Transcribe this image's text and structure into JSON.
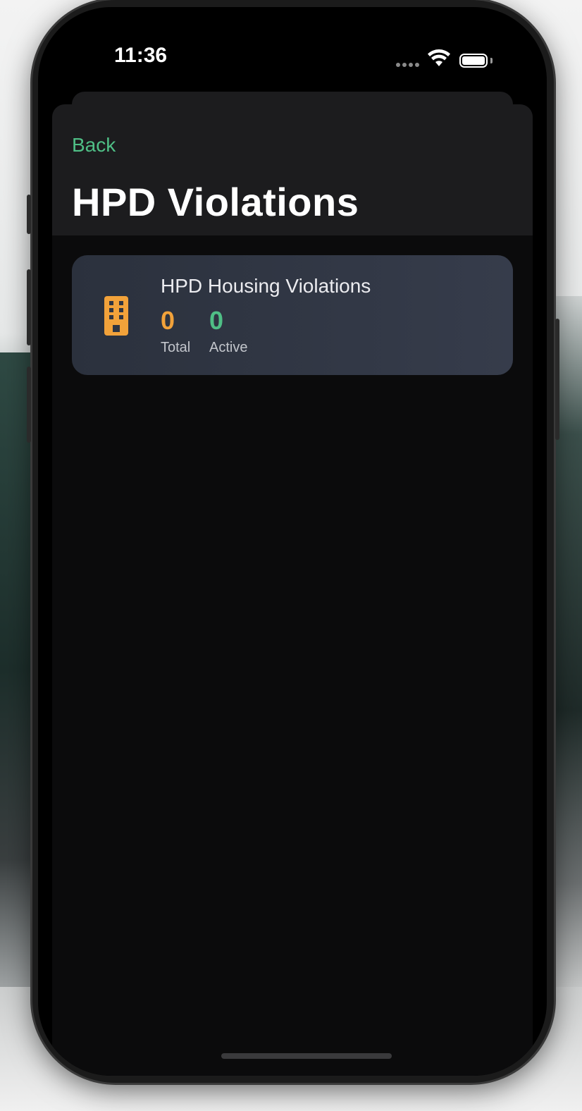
{
  "status_bar": {
    "time": "11:36"
  },
  "nav": {
    "back_label": "Back",
    "title": "HPD Violations"
  },
  "card": {
    "icon": "building-icon",
    "title": "HPD Housing Violations",
    "stats": [
      {
        "value": "0",
        "label": "Total",
        "color": "#f2a23a"
      },
      {
        "value": "0",
        "label": "Active",
        "color": "#4fbf86"
      }
    ]
  },
  "colors": {
    "accent_green": "#4fbf86",
    "accent_orange": "#f2a23a",
    "card_bg": "#2f3542",
    "sheet_bg": "#0b0b0c",
    "nav_bg": "#1c1c1e"
  }
}
